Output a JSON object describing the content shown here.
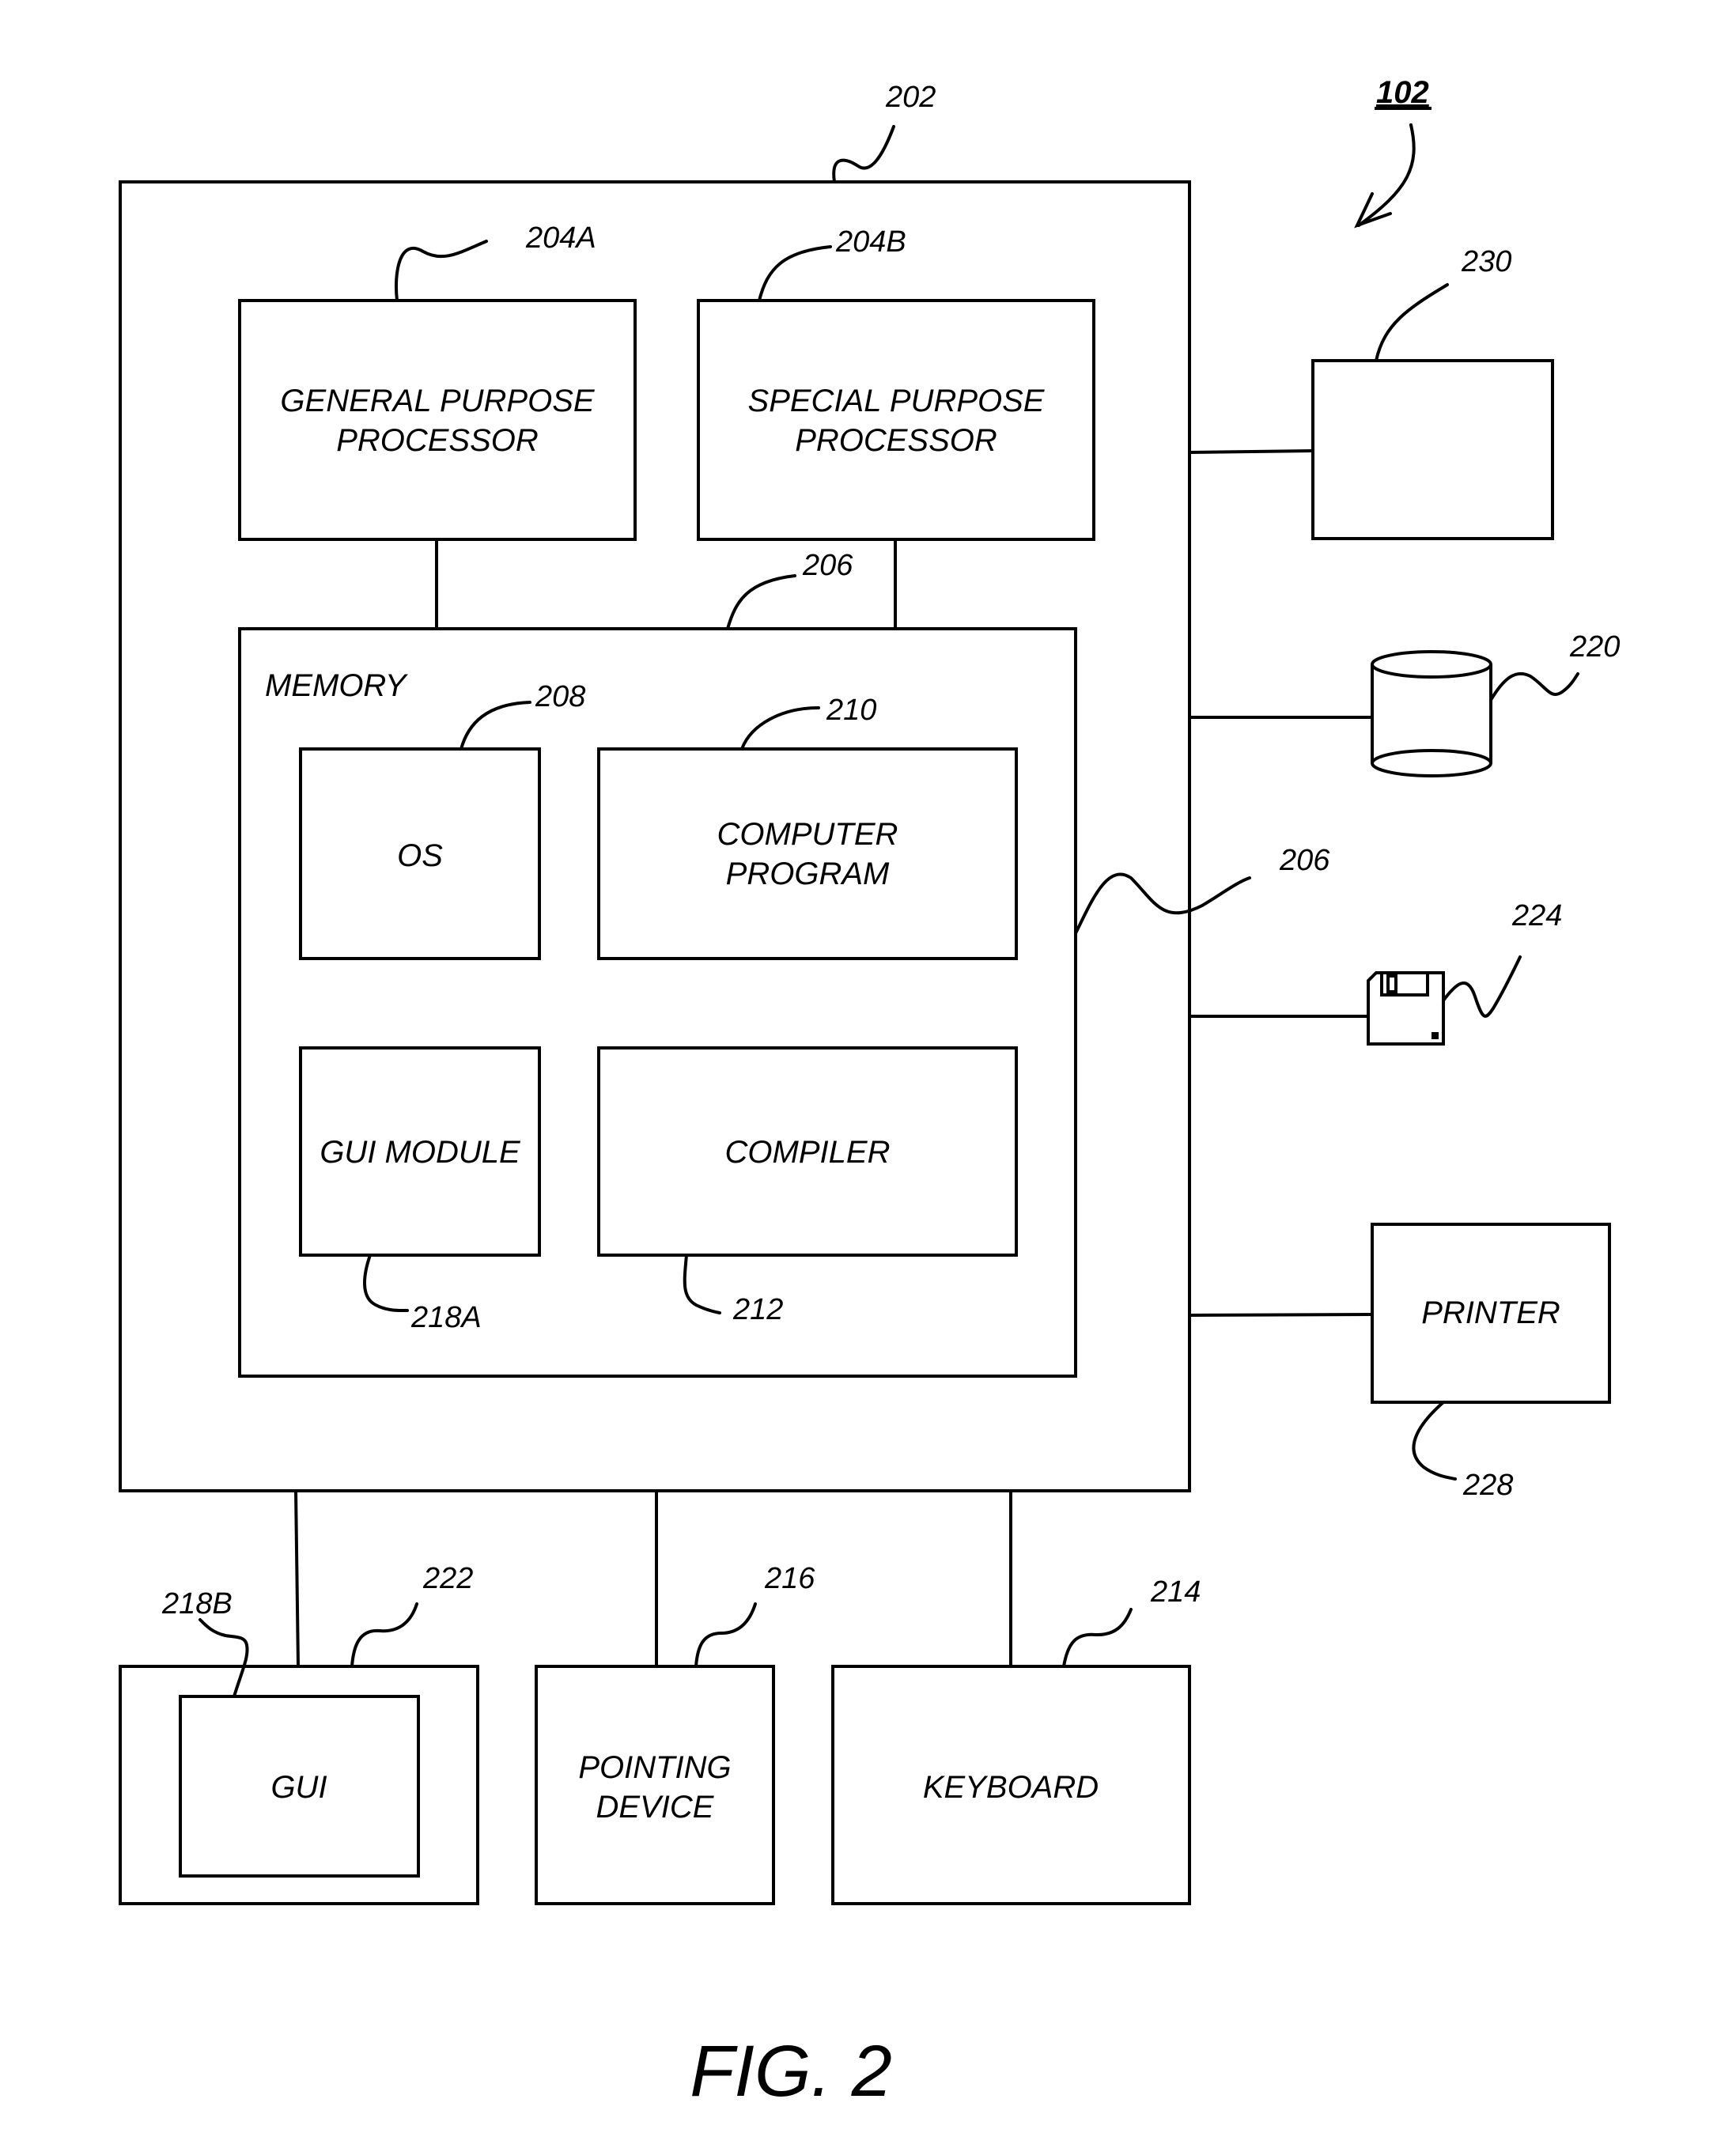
{
  "figure": {
    "title": "FIG. 2",
    "system_ref": "102"
  },
  "computer": {
    "ref": "202",
    "processors": [
      {
        "ref": "204A",
        "line1": "GENERAL PURPOSE",
        "line2": "PROCESSOR"
      },
      {
        "ref": "204B",
        "line1": "SPECIAL PURPOSE",
        "line2": "PROCESSOR"
      }
    ],
    "bus_ref": "206",
    "bus_ref_side": "206",
    "memory": {
      "label": "MEMORY",
      "os": {
        "ref": "208",
        "label": "OS"
      },
      "program": {
        "ref": "210",
        "line1": "COMPUTER",
        "line2": "PROGRAM"
      },
      "gui_module": {
        "ref": "218A",
        "label": "GUI MODULE"
      },
      "compiler": {
        "ref": "212",
        "label": "COMPILER"
      }
    }
  },
  "peripherals": {
    "display_box": {
      "ref": "230"
    },
    "data_storage": {
      "ref": "220",
      "icon": "database-cylinder-icon"
    },
    "removable_storage": {
      "ref": "224",
      "icon": "floppy-disk-icon"
    },
    "printer": {
      "ref": "228",
      "label": "PRINTER"
    },
    "monitor": {
      "ref": "222",
      "gui_ref": "218B",
      "gui_label": "GUI"
    },
    "pointing_device": {
      "ref": "216",
      "line1": "POINTING",
      "line2": "DEVICE"
    },
    "keyboard": {
      "ref": "214",
      "label": "KEYBOARD"
    }
  }
}
